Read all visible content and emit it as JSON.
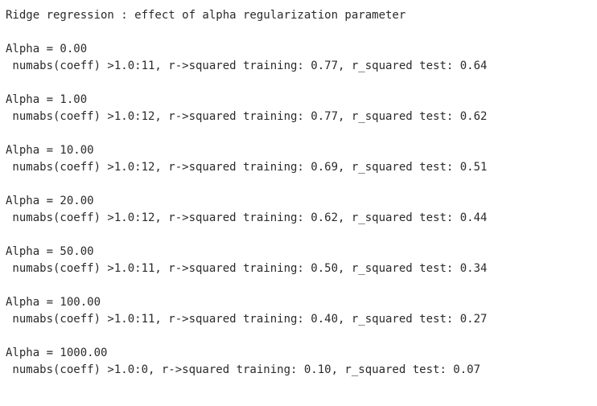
{
  "output": {
    "title": "Ridge regression : effect of alpha regularization parameter",
    "blocks": [
      {
        "alpha_line": "Alpha = 0.00",
        "result_line": " numabs(coeff) >1.0:11, r->squared training: 0.77, r_squared test: 0.64"
      },
      {
        "alpha_line": "Alpha = 1.00",
        "result_line": " numabs(coeff) >1.0:12, r->squared training: 0.77, r_squared test: 0.62"
      },
      {
        "alpha_line": "Alpha = 10.00",
        "result_line": " numabs(coeff) >1.0:12, r->squared training: 0.69, r_squared test: 0.51"
      },
      {
        "alpha_line": "Alpha = 20.00",
        "result_line": " numabs(coeff) >1.0:12, r->squared training: 0.62, r_squared test: 0.44"
      },
      {
        "alpha_line": "Alpha = 50.00",
        "result_line": " numabs(coeff) >1.0:11, r->squared training: 0.50, r_squared test: 0.34"
      },
      {
        "alpha_line": "Alpha = 100.00",
        "result_line": " numabs(coeff) >1.0:11, r->squared training: 0.40, r_squared test: 0.27"
      },
      {
        "alpha_line": "Alpha = 1000.00",
        "result_line": " numabs(coeff) >1.0:0, r->squared training: 0.10, r_squared test: 0.07"
      }
    ]
  }
}
